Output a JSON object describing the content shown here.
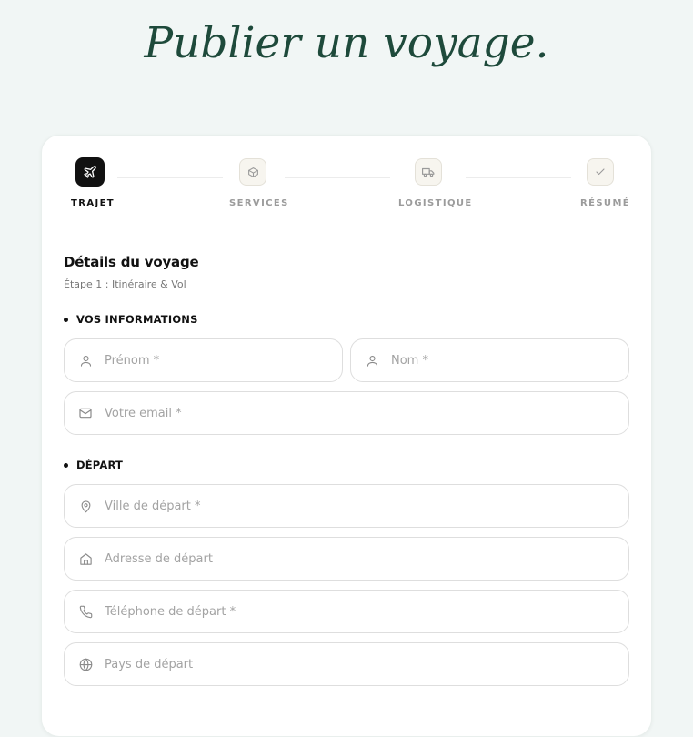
{
  "page": {
    "title": "Publier un voyage."
  },
  "steps": [
    {
      "label": "TRAJET",
      "icon": "plane-icon",
      "active": true
    },
    {
      "label": "SERVICES",
      "icon": "package-icon",
      "active": false
    },
    {
      "label": "LOGISTIQUE",
      "icon": "truck-icon",
      "active": false
    },
    {
      "label": "RÉSUMÉ",
      "icon": "check-icon",
      "active": false
    }
  ],
  "form": {
    "title": "Détails du voyage",
    "subtitle": "Étape 1 : Itinéraire & Vol",
    "sections": {
      "info": {
        "title": "VOS INFORMATIONS",
        "firstname": {
          "placeholder": "Prénom *",
          "value": "",
          "icon": "user-icon"
        },
        "lastname": {
          "placeholder": "Nom *",
          "value": "",
          "icon": "user-icon"
        },
        "email": {
          "placeholder": "Votre email *",
          "value": "",
          "icon": "mail-icon"
        }
      },
      "departure": {
        "title": "DÉPART",
        "city": {
          "placeholder": "Ville de départ *",
          "value": "",
          "icon": "map-pin-icon"
        },
        "address": {
          "placeholder": "Adresse de départ",
          "value": "",
          "icon": "home-icon"
        },
        "phone": {
          "placeholder": "Téléphone de départ *",
          "value": "",
          "icon": "phone-icon"
        },
        "country": {
          "placeholder": "Pays de départ",
          "value": "",
          "icon": "globe-icon"
        }
      }
    }
  },
  "colors": {
    "background": "#f1f6f5",
    "title": "#1e4a3b",
    "active_step": "#111111",
    "inactive_step_bg": "#f7f5ef",
    "input_border": "#dedede",
    "placeholder": "#a3a3a3"
  }
}
